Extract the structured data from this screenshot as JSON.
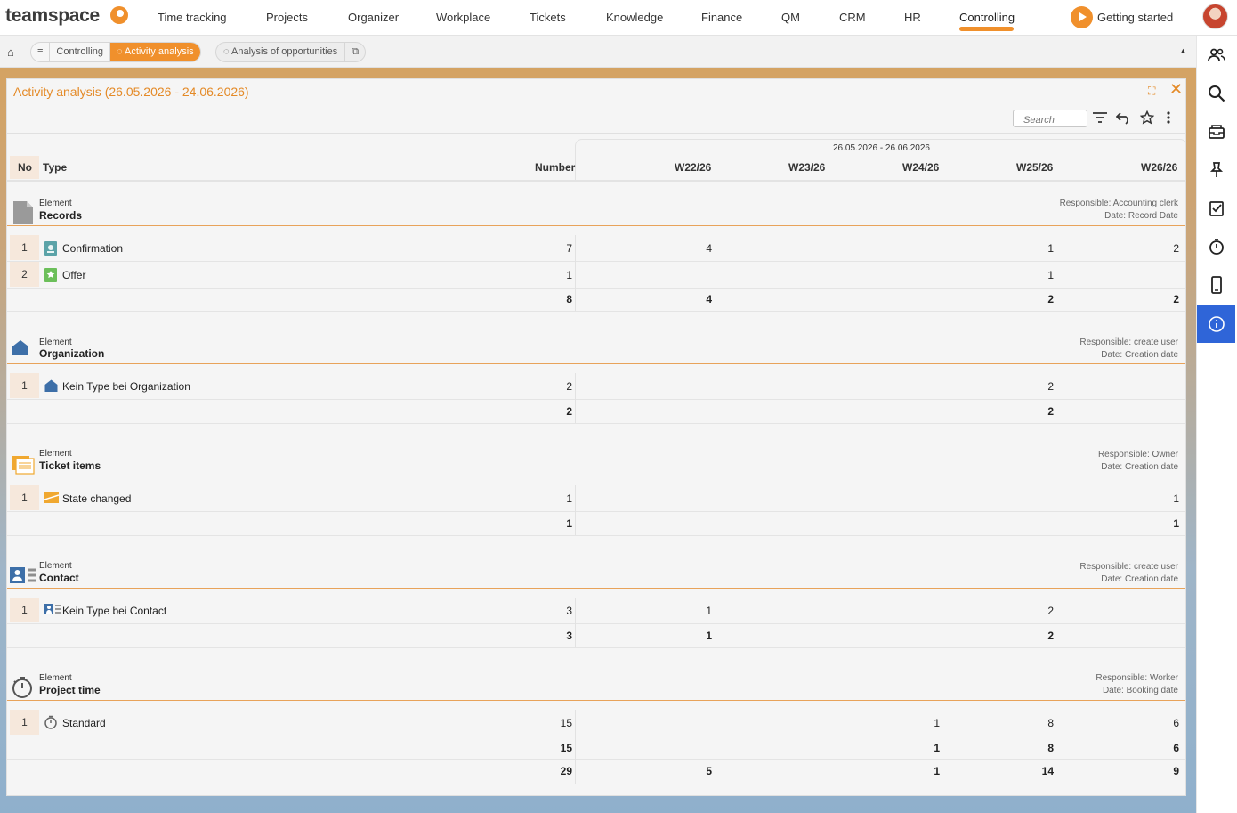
{
  "app": {
    "logo_text": "teamspace",
    "nav": [
      "Time tracking",
      "Projects",
      "Organizer",
      "Workplace",
      "Tickets",
      "Knowledge",
      "Finance",
      "QM",
      "CRM",
      "HR",
      "Controlling"
    ],
    "active_nav": "Controlling",
    "getting_started": "Getting started",
    "accent_color": "#f0902c",
    "sidebar_active_color": "#2f65d8"
  },
  "breadcrumb": {
    "menu_glyph": "≡",
    "items": [
      "Controlling",
      "Activity analysis"
    ],
    "secondary_tab": "Analysis of opportunities"
  },
  "panel": {
    "title": "Activity analysis (26.05.2026 - 24.06.2026)",
    "search_placeholder": "Search"
  },
  "table": {
    "headers": {
      "no": "No",
      "type": "Type",
      "number": "Number"
    },
    "date_range": "26.05.2026 - 26.06.2026",
    "weeks": [
      "W22/26",
      "W23/26",
      "W24/26",
      "W25/26",
      "W26/26"
    ]
  },
  "sections": [
    {
      "label": "Element",
      "title": "Records",
      "responsible": "Responsible: Accounting clerk",
      "date": "Date: Record Date",
      "rows": [
        {
          "no": "1",
          "type": "Confirmation",
          "number": "7",
          "w": [
            "4",
            "",
            "",
            "1",
            "2"
          ]
        },
        {
          "no": "2",
          "type": "Offer",
          "number": "1",
          "w": [
            "",
            "",
            "",
            "1",
            ""
          ]
        }
      ],
      "total": {
        "number": "8",
        "w": [
          "4",
          "",
          "",
          "2",
          "2"
        ]
      }
    },
    {
      "label": "Element",
      "title": "Organization",
      "responsible": "Responsible: create user",
      "date": "Date: Creation date",
      "rows": [
        {
          "no": "1",
          "type": "Kein Type bei Organization",
          "number": "2",
          "w": [
            "",
            "",
            "",
            "2",
            ""
          ]
        }
      ],
      "total": {
        "number": "2",
        "w": [
          "",
          "",
          "",
          "2",
          ""
        ]
      }
    },
    {
      "label": "Element",
      "title": "Ticket items",
      "responsible": "Responsible: Owner",
      "date": "Date: Creation date",
      "rows": [
        {
          "no": "1",
          "type": "State changed",
          "number": "1",
          "w": [
            "",
            "",
            "",
            "",
            "1"
          ]
        }
      ],
      "total": {
        "number": "1",
        "w": [
          "",
          "",
          "",
          "",
          "1"
        ]
      }
    },
    {
      "label": "Element",
      "title": "Contact",
      "responsible": "Responsible: create user",
      "date": "Date: Creation date",
      "rows": [
        {
          "no": "1",
          "type": "Kein Type bei Contact",
          "number": "3",
          "w": [
            "1",
            "",
            "",
            "2",
            ""
          ]
        }
      ],
      "total": {
        "number": "3",
        "w": [
          "1",
          "",
          "",
          "2",
          ""
        ]
      }
    },
    {
      "label": "Element",
      "title": "Project time",
      "responsible": "Responsible: Worker",
      "date": "Date: Booking date",
      "rows": [
        {
          "no": "1",
          "type": "Standard",
          "number": "15",
          "w": [
            "",
            "",
            "1",
            "8",
            "6"
          ]
        }
      ],
      "total": {
        "number": "15",
        "w": [
          "",
          "",
          "1",
          "8",
          "6"
        ]
      }
    }
  ],
  "grand_total": {
    "number": "29",
    "w": [
      "5",
      "",
      "1",
      "14",
      "9"
    ]
  }
}
